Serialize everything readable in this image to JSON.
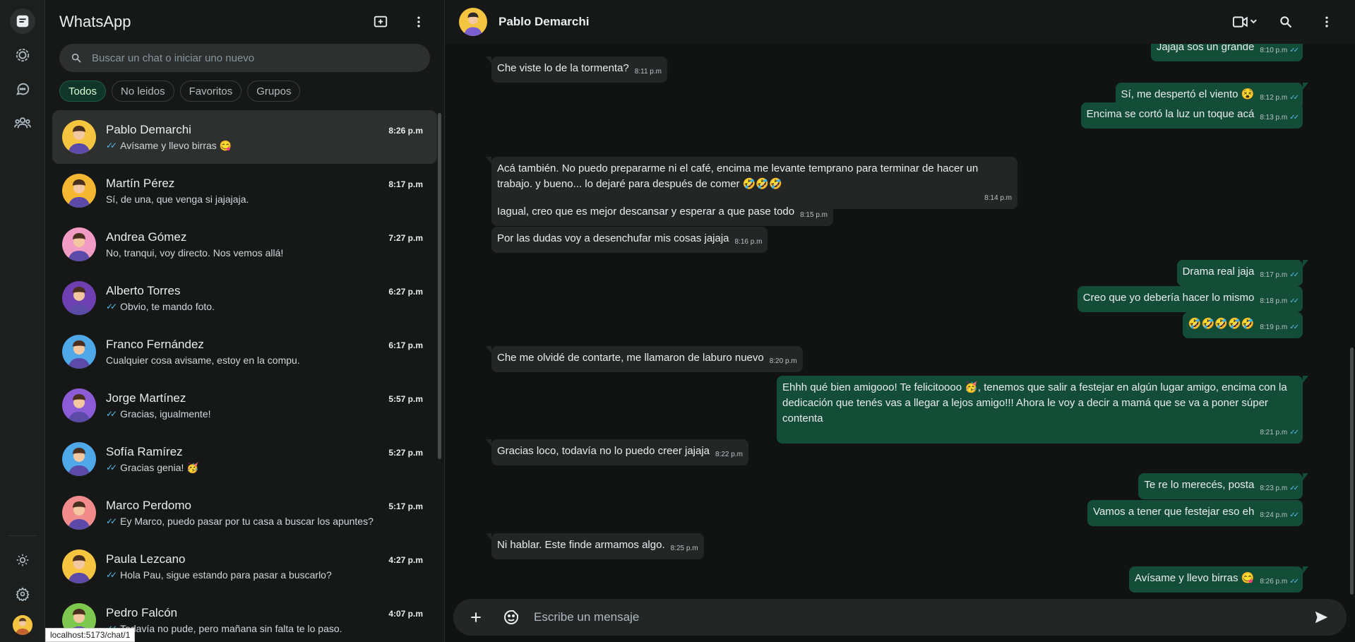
{
  "app": {
    "title": "WhatsApp"
  },
  "search": {
    "placeholder": "Buscar un chat o iniciar uno nuevo"
  },
  "filters": [
    "Todos",
    "No leidos",
    "Favoritos",
    "Grupos"
  ],
  "chats": [
    {
      "name": "Pablo Demarchi",
      "time": "8:26 p.m",
      "preview": "Avísame y llevo birras 😋",
      "read": true,
      "color": "#f5c542"
    },
    {
      "name": "Martín Pérez",
      "time": "8:17 p.m",
      "preview": "Sí, de una, que venga si jajajaja.",
      "read": false,
      "color": "#f5b731"
    },
    {
      "name": "Andrea Gómez",
      "time": "7:27 p.m",
      "preview": "No, tranqui, voy directo. Nos vemos allá!",
      "read": false,
      "color": "#f29bc4"
    },
    {
      "name": "Alberto Torres",
      "time": "6:27 p.m",
      "preview": "Obvio, te mando foto.",
      "read": true,
      "color": "#6d3fb0"
    },
    {
      "name": "Franco Fernández",
      "time": "6:17 p.m",
      "preview": "Cualquier cosa avisame, estoy en la compu.",
      "read": false,
      "color": "#4fa8e8"
    },
    {
      "name": "Jorge Martínez",
      "time": "5:57 p.m",
      "preview": "Gracias, igualmente!",
      "read": true,
      "color": "#8c5cd6"
    },
    {
      "name": "Sofía Ramírez",
      "time": "5:27 p.m",
      "preview": "Gracias genia! 🥳",
      "read": true,
      "color": "#4fa8e8"
    },
    {
      "name": "Marco Perdomo",
      "time": "5:17 p.m",
      "preview": "Ey Marco, puedo pasar por tu casa a buscar los apuntes?",
      "read": true,
      "color": "#f28b8b"
    },
    {
      "name": "Paula Lezcano",
      "time": "4:27 p.m",
      "preview": "Hola Pau, sigue estando para pasar a buscarlo?",
      "read": true,
      "color": "#f5c542"
    },
    {
      "name": "Pedro Falcón",
      "time": "4:07 p.m",
      "preview": "Todavía no pude, pero mañana sin falta te lo paso.",
      "read": true,
      "color": "#7ec850"
    }
  ],
  "conversation": {
    "name": "Pablo Demarchi",
    "messages": [
      {
        "dir": "out",
        "text": "Jajaja sos un grande",
        "time": "8:10 p.m"
      },
      {
        "dir": "in",
        "text": "Che viste lo de la tormenta?",
        "time": "8:11 p.m"
      },
      {
        "dir": "out",
        "text": "Sí, me despertó el viento 😵",
        "time": "8:12 p.m"
      },
      {
        "dir": "out",
        "text": "Encima se cortó la luz un toque acá",
        "time": "8:13 p.m"
      },
      {
        "dir": "in",
        "text": "Acá también. No puedo prepararme ni el café, encima me levante temprano para terminar de hacer un trabajo. y bueno... lo dejaré para después de comer 🤣🤣🤣",
        "time": "8:14 p.m"
      },
      {
        "dir": "in",
        "text": "Iagual, creo que es mejor descansar y esperar a que pase todo",
        "time": "8:15 p.m"
      },
      {
        "dir": "in",
        "text": "Por las dudas voy a desenchufar mis cosas jajaja",
        "time": "8:16 p.m"
      },
      {
        "dir": "out",
        "text": "Drama real jaja",
        "time": "8:17 p.m"
      },
      {
        "dir": "out",
        "text": "Creo que yo debería hacer lo mismo",
        "time": "8:18 p.m"
      },
      {
        "dir": "out",
        "text": "🤣🤣🤣🤣🤣",
        "time": "8:19 p.m"
      },
      {
        "dir": "in",
        "text": "Che me olvidé de contarte, me llamaron de laburo nuevo",
        "time": "8:20 p.m"
      },
      {
        "dir": "out",
        "text": "Ehhh qué bien amigooo! Te felicitoooo 🥳, tenemos que salir a festejar en algún lugar amigo, encima con la dedicación que tenés vas a llegar a lejos amigo!!! Ahora le voy a decir a mamá que se va a poner súper contenta",
        "time": "8:21 p.m"
      },
      {
        "dir": "in",
        "text": "Gracias loco, todavía no lo puedo creer jajaja",
        "time": "8:22 p.m"
      },
      {
        "dir": "out",
        "text": "Te re lo merecés, posta",
        "time": "8:23 p.m"
      },
      {
        "dir": "out",
        "text": "Vamos a tener que festejar eso eh",
        "time": "8:24 p.m"
      },
      {
        "dir": "in",
        "text": "Ni hablar. Este finde armamos algo.",
        "time": "8:25 p.m"
      },
      {
        "dir": "out",
        "text": "Avísame y llevo birras 😋",
        "time": "8:26 p.m"
      }
    ]
  },
  "composer": {
    "placeholder": "Escribe un mensaje"
  },
  "status_bar": {
    "url": "localhost:5173/chat/1"
  },
  "colors": {
    "accent": "#144d37",
    "read_ticks": "#53bdeb",
    "background": "#161717"
  }
}
